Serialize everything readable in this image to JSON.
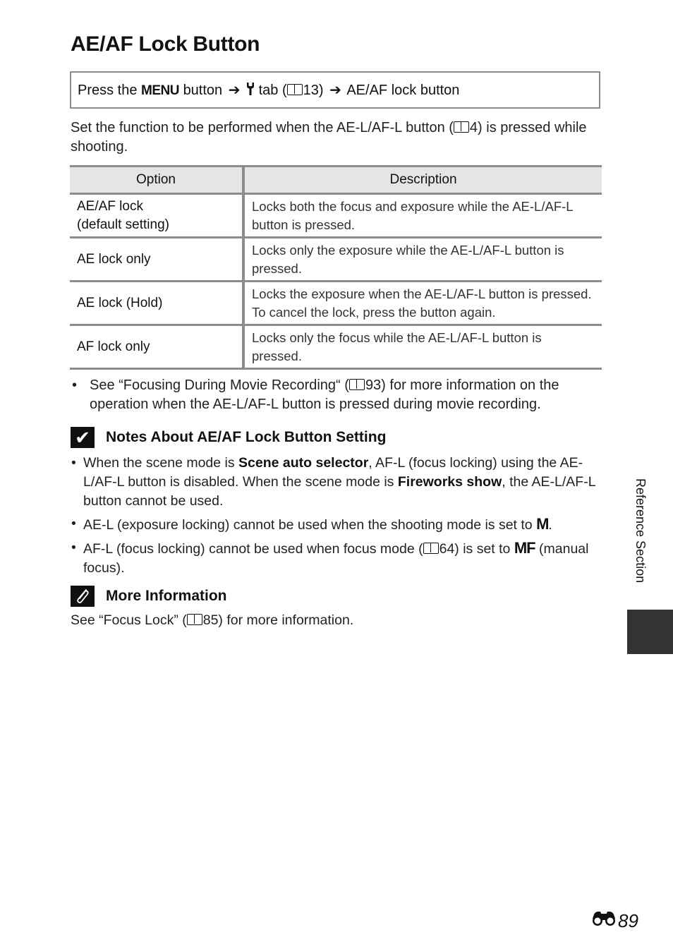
{
  "page": {
    "title": "AE/AF Lock Button",
    "menu_path": {
      "prefix": "Press the",
      "menu_symbol": "MENU",
      "button_word": "button",
      "tab_symbol": "wrench",
      "tab_word": "tab (",
      "tab_ref": "13)",
      "destination": "AE/AF lock button"
    },
    "intro": {
      "before_ref": "Set the function to be performed when the AE-L/AF-L button (",
      "ref": "4) is pressed while shooting."
    },
    "table": {
      "headers": [
        "Option",
        "Description"
      ],
      "rows": [
        {
          "option_line1": "AE/AF lock",
          "option_line2": "(default setting)",
          "description": "Locks both the focus and exposure while the AE-L/AF-L button is pressed."
        },
        {
          "option_line1": "AE lock only",
          "option_line2": "",
          "description": "Locks only the exposure while the AE-L/AF-L button is pressed."
        },
        {
          "option_line1": "AE lock (Hold)",
          "option_line2": "",
          "description": "Locks the exposure when the AE-L/AF-L button is pressed. To cancel the lock, press the button again."
        },
        {
          "option_line1": "AF lock only",
          "option_line2": "",
          "description": "Locks only the focus while the AE-L/AF-L button is pressed."
        }
      ]
    },
    "see_note": {
      "bullet": "•",
      "before_ref": "See “Focusing During Movie Recording“ (",
      "ref": "93) for more information on the operation when the AE-L/AF-L button is pressed during movie recording."
    },
    "notes": {
      "icon": "check-icon",
      "icon_glyph": "✔",
      "heading": "Notes About AE/AF Lock Button Setting",
      "items": [
        {
          "part1": "When the scene mode is ",
          "bold1": "Scene auto selector",
          "part2": ", AF-L (focus locking) using the AE-L/AF-L button is disabled. When the scene mode is ",
          "bold2": "Fireworks show",
          "part3": ", the AE-L/AF-L button cannot be used."
        },
        {
          "text": "AE-L (exposure locking) cannot be used when the shooting mode is set to ",
          "symbol": "M",
          "end": "."
        },
        {
          "text": "AF-L (focus locking) cannot be used when focus mode (",
          "ref": "64) is set to ",
          "symbol": "MF",
          "end": " (manual focus)."
        }
      ]
    },
    "more_info": {
      "icon": "paperclip-icon",
      "heading": "More Information",
      "before_ref": "See “Focus Lock” (",
      "ref": "85) for more information."
    },
    "side_tab": {
      "label": "Reference Section",
      "color": "#333333"
    },
    "page_number": {
      "icon": "binoculars-icon",
      "number": "89"
    }
  }
}
